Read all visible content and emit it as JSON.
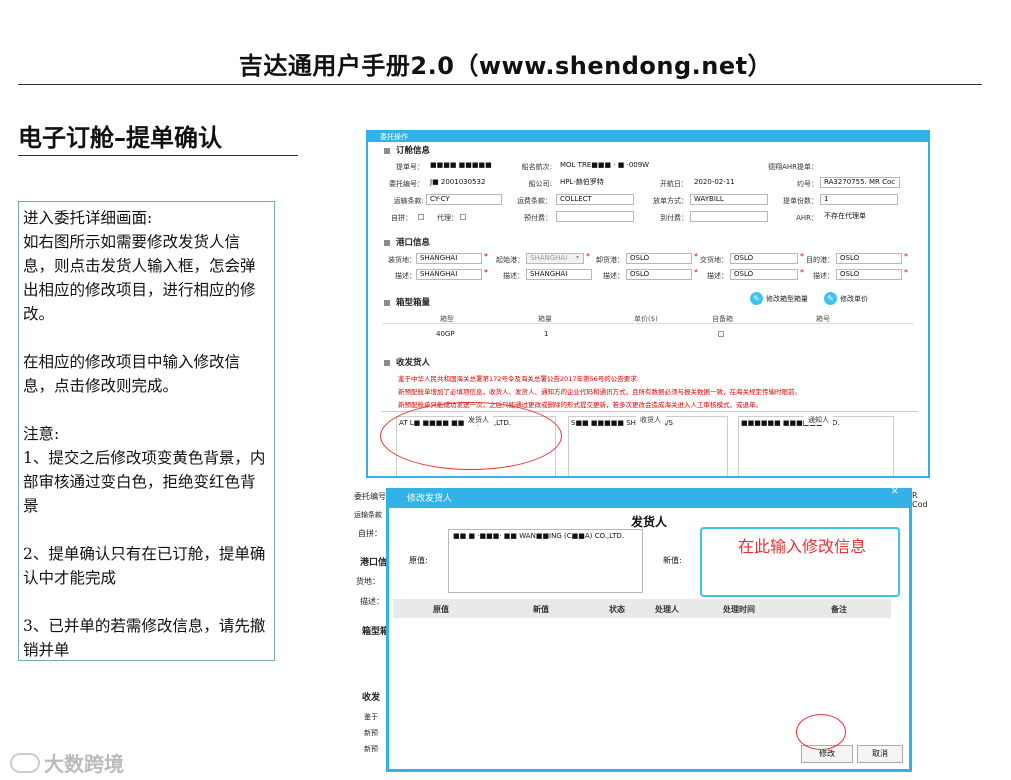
{
  "header": {
    "title": "吉达通用户手册2.0（www.shendong.net）"
  },
  "section": {
    "title": "电子订舱–提单确认"
  },
  "notes": {
    "text": "进入委托详细画面:\n如右图所示如需要修改发货人信息，则点击发货人输入框，怎会弹出相应的修改项目，进行相应的修改。\n\n在相应的修改项目中输入修改信息，点击修改则完成。\n\n注意:\n1、提交之后修改项变黄色背景，内部审核通过变白色，拒绝变红色背景\n\n2、提单确认只有在已订舱，提单确认中才能完成\n\n3、已并单的若需修改信息，请先撤销并单"
  },
  "watermark": {
    "text": "大数跨境"
  },
  "top_window": {
    "title": "委托操作",
    "booking_section": "订舱信息",
    "fields": {
      "bill_no_label": "提单号：",
      "bill_no_value": "■■■■ ■■■■■",
      "vessel_label": "船名航次:",
      "vessel_value": "MOL TRE■■■ · ■ ·009W",
      "ahr_label": "德翔AHR提单：",
      "entrust_label": "委托编号：",
      "entrust_value": "J■ 2001030532",
      "carrier_label": "船公司:",
      "carrier_value": "HPL-赫伯罗特",
      "sail_label": "开航日：",
      "sail_value": "2020-02-11",
      "contract_label": "约号：",
      "contract_value": "RA3270755. MR Coc",
      "transport_label": "运输条款:",
      "transport_value": "CY-CY",
      "freight_label": "运费条款：",
      "freight_value": "COLLECT",
      "release_label": "放单方式：",
      "release_value": "WAYBILL",
      "copies_label": "提单份数：",
      "copies_value": "1",
      "self_label": "自拼：",
      "agent_label": "代理：",
      "prepay_label": "预付费：",
      "collect_label": "到付费：",
      "ahr2_label": "AHR：",
      "ahr2_value": "不存在代理单"
    },
    "port_section": "港口信息",
    "ports": {
      "load_label": "装货地：",
      "load_value": "SHANGHAI",
      "origin_label": "起始港：",
      "origin_value": "SHANGHAI",
      "discharge_label": "卸货港：",
      "discharge_value": "OSLO",
      "delivery_label": "交货地：",
      "delivery_value": "OSLO",
      "dest_label": "目的港：",
      "dest_value": "OSLO",
      "desc_label": "描述：",
      "desc1": "SHANGHAI",
      "desc2": "SHANGHAI",
      "desc3": "OSLO",
      "desc4": "OSLO",
      "desc5": "OSLO"
    },
    "container_section": "箱型箱量",
    "container_buttons": {
      "edit_type": "修改箱型箱量",
      "edit_price": "修改单价"
    },
    "container_table": {
      "headers": [
        "箱型",
        "箱量",
        "单价($)",
        "自备箱",
        "箱号"
      ],
      "row": [
        "40GP",
        "1"
      ]
    },
    "party_section": "收发货人",
    "notice_lines": [
      "鉴于中华人民共和国海关总署第172号令及海关总署公告2017年第56号的公告要求:",
      "新预配舱单增加了必填项信息，收货人、发货人、通知方的企业代码和通讯方式，且所有数据必须与报关数据一致，在海关规定传输时限前。",
      "新预配舱单只能成功发送一次，之后只能通过更改或删除的形式提交更新，若多次更改会造成海关进入人工审核模式，或退单。"
    ],
    "parties": {
      "shipper_label": "发货人",
      "shipper_value": "AT L■ ■■■■ ■■ NA) CO.,LTD.",
      "consignee_label": "收货人",
      "consignee_value": "S■■ ■■■■■ SHIPPING A/S",
      "notify_label": "通知人",
      "notify_value": "■■■■■■ ■■■■■■ LTD."
    }
  },
  "bg_window": {
    "rows": [
      "委托编号",
      "运输条款",
      "自拼：",
      "港口信",
      "货地：",
      "描述：",
      "箱型箱",
      "收发",
      "鉴于",
      "新预",
      "新预"
    ],
    "right": "R Cod"
  },
  "dialog": {
    "title": "修改发货人",
    "heading": "发货人",
    "old_label": "原值:",
    "old_value": "■■ ■ ·■■■· ■■ WAN■■ING (C■■A) CO.,LTD.",
    "new_label": "新值:",
    "hint": "在此输入修改信息",
    "table_headers": [
      "原值",
      "新值",
      "状态",
      "处理人",
      "处理时间",
      "备注"
    ],
    "modify_label": "修改",
    "cancel_label": "取消",
    "close": "✕"
  }
}
